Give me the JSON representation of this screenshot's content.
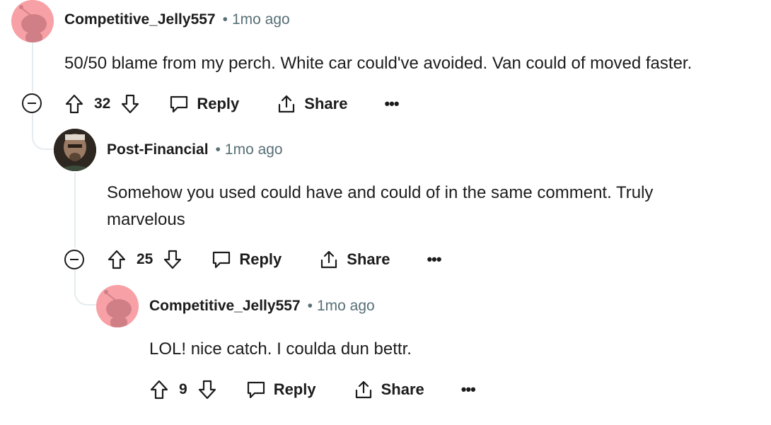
{
  "comments": [
    {
      "username": "Competitive_Jelly557",
      "separator": "•",
      "time": "1mo ago",
      "body": "50/50 blame from my perch. White car could've avoided. Van could of moved faster.",
      "votes": "32",
      "reply_label": "Reply",
      "share_label": "Share",
      "more_label": "•••",
      "avatar": "snoo-avatar"
    },
    {
      "username": "Post-Financial",
      "separator": "•",
      "time": "1mo ago",
      "body": "Somehow you used could have and could of in the same comment. Truly marvelous",
      "votes": "25",
      "reply_label": "Reply",
      "share_label": "Share",
      "more_label": "•••",
      "avatar": "user-photo"
    },
    {
      "username": "Competitive_Jelly557",
      "separator": "•",
      "time": "1mo ago",
      "body": "LOL! nice catch. I coulda dun bettr.",
      "votes": "9",
      "reply_label": "Reply",
      "share_label": "Share",
      "more_label": "•••",
      "avatar": "snoo-avatar"
    }
  ],
  "colors": {
    "snoo_background": "#f7a1a6",
    "snoo_figure": "#d17f87",
    "thread_line": "#e5ebee",
    "meta_text": "#576f76"
  }
}
